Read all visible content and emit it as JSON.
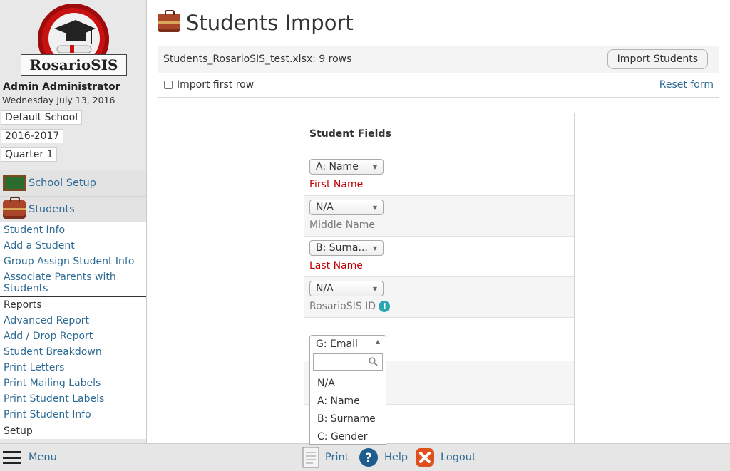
{
  "app": {
    "logo_text": "RosarioSIS"
  },
  "sidebar": {
    "user_name": "Admin Administrator",
    "date": "Wednesday July 13, 2016",
    "school": "Default School",
    "year": "2016-2017",
    "period": "Quarter 1",
    "modules": [
      {
        "label": "School Setup",
        "icon": "chalkboard-icon"
      },
      {
        "label": "Students",
        "icon": "briefcase-icon"
      }
    ],
    "student_items": [
      "Student Info",
      "Add a Student",
      "Group Assign Student Info",
      "Associate Parents with Students"
    ],
    "reports_heading": "Reports",
    "report_items": [
      "Advanced Report",
      "Add / Drop Report",
      "Student Breakdown",
      "Print Letters",
      "Print Mailing Labels",
      "Print Student Labels",
      "Print Student Info"
    ],
    "setup_heading": "Setup"
  },
  "main": {
    "title": "Students Import",
    "file_info": "Students_RosarioSIS_test.xlsx: 9 rows",
    "import_button": "Import Students",
    "import_first_row": "Import first row",
    "reset_form": "Reset form",
    "table_header": "Student Fields",
    "fields": [
      {
        "selected": "A: Name",
        "label": "First Name"
      },
      {
        "selected": "N/A",
        "label": "Middle Name"
      },
      {
        "selected": "B: Surna...",
        "label": "Last Name"
      },
      {
        "selected": "N/A",
        "label": "RosarioSIS ID"
      },
      {
        "selected": "G: Email",
        "label": ""
      }
    ]
  },
  "dropdown": {
    "selected": "G: Email",
    "search_placeholder": "",
    "options": [
      "N/A",
      "A: Name",
      "B: Surname",
      "C: Gender"
    ]
  },
  "footer": {
    "menu": "Menu",
    "print": "Print",
    "help": "Help",
    "logout": "Logout"
  },
  "colors": {
    "link": "#2d6a94",
    "required": "#c10000",
    "info": "#2aa7b0"
  }
}
